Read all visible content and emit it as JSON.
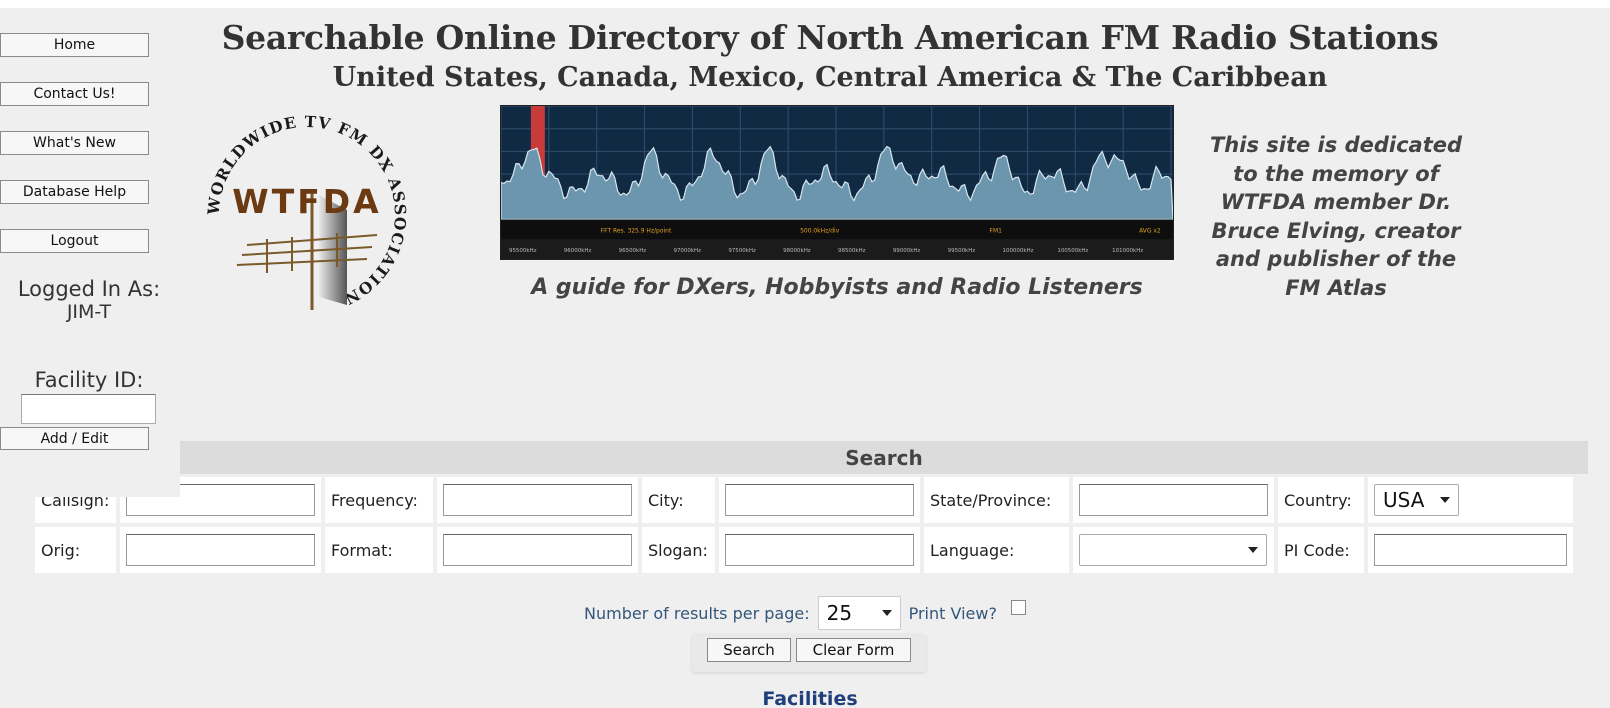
{
  "nav": {
    "home": "Home",
    "contact": "Contact Us!",
    "whats_new": "What's New",
    "db_help": "Database Help",
    "logout": "Logout",
    "add_edit": "Add / Edit"
  },
  "user": {
    "label": "Logged In As:",
    "name": "JIM-T"
  },
  "facility": {
    "label": "Facility ID:",
    "value": ""
  },
  "header": {
    "title": "Searchable Online Directory of North American FM Radio Stations",
    "subtitle": "United States, Canada, Mexico, Central America & The Caribbean",
    "tagline": "A guide for DXers, Hobbyists and Radio Listeners",
    "dedication": "This site is dedicated to the memory of WTFDA member Dr. Bruce Elving, creator and publisher of the FM Atlas"
  },
  "logo": {
    "ring_text": "WORLDWIDE TV FM DX ASSOCIATION",
    "letters": "WTFDA"
  },
  "spectrum": {
    "status_left": "FFT Res. 325.9 Hz/point",
    "status_mid": "500.0kHz/div",
    "status_right": "FM1",
    "status_far": "AVG x2",
    "freq_ticks": [
      "95500kHz",
      "96000kHz",
      "96500kHz",
      "97000kHz",
      "97500kHz",
      "98000kHz",
      "98500kHz",
      "99000kHz",
      "99500kHz",
      "100000kHz",
      "100500kHz",
      "101000kHz"
    ]
  },
  "search": {
    "header": "Search",
    "callsign_label": "Callsign:",
    "frequency_label": "Frequency:",
    "city_label": "City:",
    "state_label": "State/Province:",
    "country_label": "Country:",
    "country_value": "USA",
    "orig_label": "Orig:",
    "format_label": "Format:",
    "slogan_label": "Slogan:",
    "language_label": "Language:",
    "language_value": "",
    "pi_label": "PI Code:",
    "results_label": "Number of results per page:",
    "results_value": "25",
    "print_label": "Print View?",
    "search_button": "Search",
    "clear_button": "Clear Form"
  },
  "facilities_heading": "Facilities"
}
